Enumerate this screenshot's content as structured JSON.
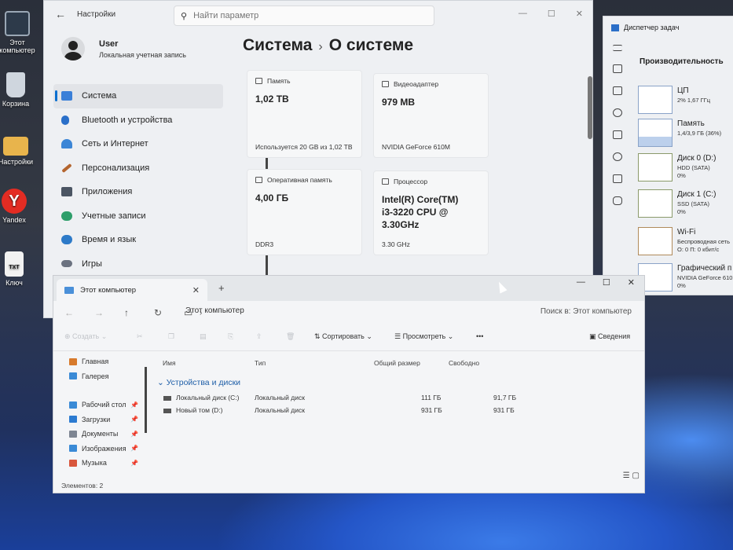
{
  "desktop": {
    "icons": [
      {
        "label": "Этот компьютер"
      },
      {
        "label": "Корзина"
      },
      {
        "label": "Настройки"
      },
      {
        "label": "Yandex"
      },
      {
        "label": "Ключ"
      }
    ],
    "txt_badge": "TXT"
  },
  "settings": {
    "title": "Настройки",
    "search_placeholder": "Найти параметр",
    "user": {
      "name": "User",
      "account_type": "Локальная учетная запись"
    },
    "breadcrumb": {
      "parent": "Система",
      "current": "О системе",
      "separator": "›"
    },
    "nav": [
      {
        "label": "Система",
        "icon": "system-icon",
        "color": "#3a7fd8"
      },
      {
        "label": "Bluetooth и устройства",
        "icon": "bluetooth-icon",
        "color": "#2a6fc9"
      },
      {
        "label": "Сеть и Интернет",
        "icon": "wifi-icon",
        "color": "#3c86d6"
      },
      {
        "label": "Персонализация",
        "icon": "brush-icon",
        "color": "#b4652e"
      },
      {
        "label": "Приложения",
        "icon": "apps-icon",
        "color": "#4b5563"
      },
      {
        "label": "Учетные записи",
        "icon": "accounts-icon",
        "color": "#2e9e6a"
      },
      {
        "label": "Время и язык",
        "icon": "globe-clock-icon",
        "color": "#2d7ac8"
      },
      {
        "label": "Игры",
        "icon": "gamepad-icon",
        "color": "#6b7280"
      }
    ],
    "cards": [
      {
        "head": "Память",
        "value": "1,02 ТВ",
        "foot": "Используется 20 GB из 1,02 ТВ"
      },
      {
        "head": "Видеоадаптер",
        "value": "979 МВ",
        "foot": "NVIDIA GeForce 610M"
      },
      {
        "head": "Оперативная память",
        "value": "4,00 ГБ",
        "foot": "DDR3"
      },
      {
        "head": "Процессор",
        "value": "Intel(R) Core(TM) i3-3220 CPU @ 3.30GHz",
        "foot": "3.30 GHz"
      }
    ]
  },
  "taskmgr": {
    "title": "Диспетчер задач",
    "heading": "Производительность",
    "items": [
      {
        "name": "ЦП",
        "sub1": "2% 1,67 ГГц",
        "sub2": ""
      },
      {
        "name": "Память",
        "sub1": "1,4/3,9 ГБ (36%)",
        "sub2": ""
      },
      {
        "name": "Диск 0 (D:)",
        "sub1": "HDD (SATA)",
        "sub2": "0%"
      },
      {
        "name": "Диск 1 (C:)",
        "sub1": "SSD (SATA)",
        "sub2": "0%"
      },
      {
        "name": "Wi-Fi",
        "sub1": "Беспроводная сеть",
        "sub2": "О: 0 П: 0 кбит/с"
      },
      {
        "name": "Графический п",
        "sub1": "NVIDIA GeForce 610",
        "sub2": "0%"
      }
    ]
  },
  "explorer": {
    "tab_title": "Этот компьютер",
    "path": "Этот компьютер",
    "search_placeholder": "Поиск в: Этот компьютер",
    "toolbar": {
      "create": "Создать",
      "sort": "Сортировать",
      "view": "Просмотреть",
      "more": "•••",
      "details": "Сведения"
    },
    "nav": [
      {
        "label": "Главная",
        "color": "#d77a2c",
        "pin": ""
      },
      {
        "label": "Галерея",
        "color": "#3a8ad6",
        "pin": ""
      },
      {
        "label": "Рабочий стол",
        "color": "#3a8ad6",
        "pin": "📌"
      },
      {
        "label": "Загрузки",
        "color": "#2c7bd1",
        "pin": "📌"
      },
      {
        "label": "Документы",
        "color": "#7d8592",
        "pin": "📌"
      },
      {
        "label": "Изображения",
        "color": "#3a8ad6",
        "pin": "📌"
      },
      {
        "label": "Музыка",
        "color": "#d8563c",
        "pin": "📌"
      }
    ],
    "columns": {
      "name": "Имя",
      "type": "Тип",
      "total": "Общий размер",
      "free": "Свободно"
    },
    "group": "Устройства и диски",
    "drives": [
      {
        "name": "Локальный диск (C:)",
        "type": "Локальный диск",
        "total": "111 ГБ",
        "free": "91,7 ГБ"
      },
      {
        "name": "Новый том (D:)",
        "type": "Локальный диск",
        "total": "931 ГБ",
        "free": "931 ГБ"
      }
    ],
    "status": "Элементов: 2"
  }
}
